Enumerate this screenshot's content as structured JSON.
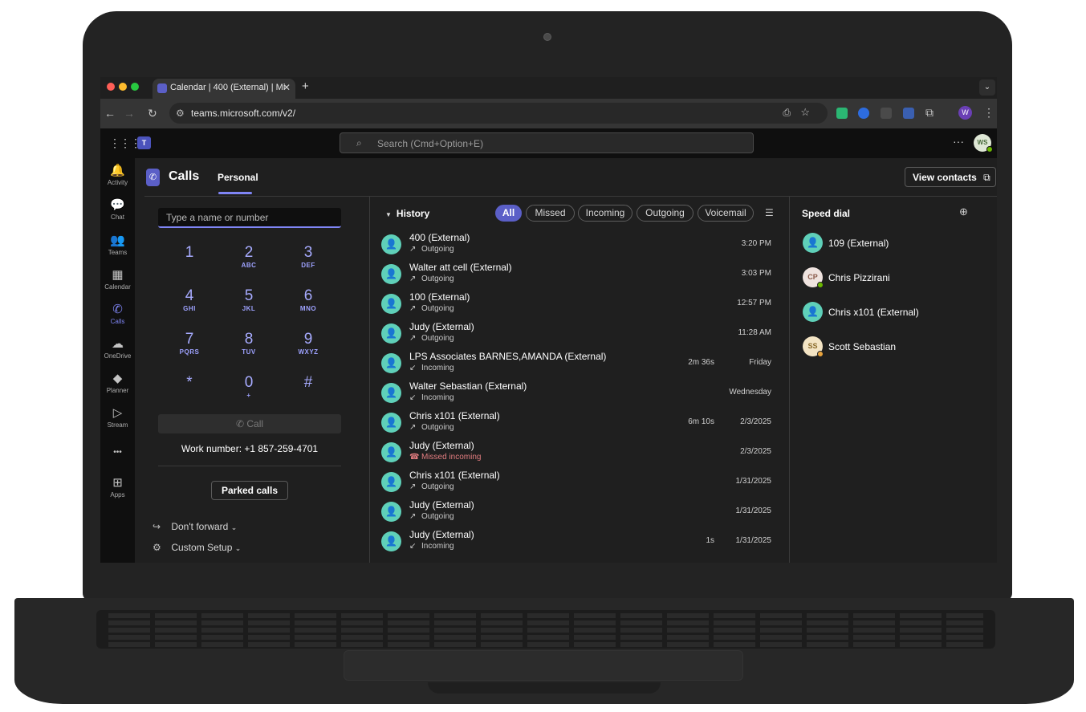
{
  "browser": {
    "tab_title": "Calendar | 400 (External) | Mi",
    "new_tab": "+",
    "tab_close": "✕",
    "url": "teams.microsoft.com/v2/"
  },
  "teams": {
    "logo": "T",
    "search_placeholder": "Search (Cmd+Option+E)",
    "more": "···",
    "me_initials": "WS",
    "profile_initial": "W"
  },
  "rail": [
    {
      "label": "Activity",
      "icon": "bell-icon",
      "glyph": "🔔"
    },
    {
      "label": "Chat",
      "icon": "chat-icon",
      "glyph": "💬"
    },
    {
      "label": "Teams",
      "icon": "teams-icon",
      "glyph": "👥"
    },
    {
      "label": "Calendar",
      "icon": "calendar-icon",
      "glyph": "▦"
    },
    {
      "label": "Calls",
      "icon": "phone-icon",
      "glyph": "✆"
    },
    {
      "label": "OneDrive",
      "icon": "cloud-icon",
      "glyph": "☁"
    },
    {
      "label": "Planner",
      "icon": "planner-icon",
      "glyph": "◆"
    },
    {
      "label": "Stream",
      "icon": "stream-icon",
      "glyph": "▷"
    },
    {
      "label": "",
      "icon": "more-apps-icon",
      "glyph": "•••"
    },
    {
      "label": "Apps",
      "icon": "apps-icon",
      "glyph": "⊞"
    }
  ],
  "header": {
    "title": "Calls",
    "tab_personal": "Personal",
    "view_contacts": "View contacts"
  },
  "dialer": {
    "placeholder": "Type a name or number",
    "keys": [
      {
        "digit": "1",
        "letters": ""
      },
      {
        "digit": "2",
        "letters": "ABC"
      },
      {
        "digit": "3",
        "letters": "DEF"
      },
      {
        "digit": "4",
        "letters": "GHI"
      },
      {
        "digit": "5",
        "letters": "JKL"
      },
      {
        "digit": "6",
        "letters": "MNO"
      },
      {
        "digit": "7",
        "letters": "PQRS"
      },
      {
        "digit": "8",
        "letters": "TUV"
      },
      {
        "digit": "9",
        "letters": "WXYZ"
      },
      {
        "digit": "*",
        "letters": ""
      },
      {
        "digit": "0",
        "letters": "+"
      },
      {
        "digit": "#",
        "letters": ""
      }
    ],
    "call_label": "Call",
    "work_number": "Work number: +1 857-259-4701",
    "parked_calls": "Parked calls",
    "dont_forward": "Don't forward",
    "custom_setup": "Custom Setup"
  },
  "history": {
    "title": "History",
    "filters": [
      "All",
      "Missed",
      "Incoming",
      "Outgoing",
      "Voicemail"
    ],
    "active_filter": "All",
    "rows": [
      {
        "name": "400 (External)",
        "direction": "Outgoing",
        "duration": "",
        "time": "3:20 PM"
      },
      {
        "name": "Walter att cell (External)",
        "direction": "Outgoing",
        "duration": "",
        "time": "3:03 PM"
      },
      {
        "name": "100 (External)",
        "direction": "Outgoing",
        "duration": "",
        "time": "12:57 PM"
      },
      {
        "name": "Judy (External)",
        "direction": "Outgoing",
        "duration": "",
        "time": "11:28 AM"
      },
      {
        "name": "LPS Associates BARNES,AMANDA (External)",
        "direction": "Incoming",
        "duration": "2m 36s",
        "time": "Friday"
      },
      {
        "name": "Walter Sebastian (External)",
        "direction": "Incoming",
        "duration": "",
        "time": "Wednesday"
      },
      {
        "name": "Chris x101 (External)",
        "direction": "Outgoing",
        "duration": "6m 10s",
        "time": "2/3/2025"
      },
      {
        "name": "Judy (External)",
        "direction": "Missed incoming",
        "duration": "",
        "time": "2/3/2025"
      },
      {
        "name": "Chris x101 (External)",
        "direction": "Outgoing",
        "duration": "",
        "time": "1/31/2025"
      },
      {
        "name": "Judy (External)",
        "direction": "Outgoing",
        "duration": "",
        "time": "1/31/2025"
      },
      {
        "name": "Judy (External)",
        "direction": "Incoming",
        "duration": "1s",
        "time": "1/31/2025"
      }
    ]
  },
  "speed_dial": {
    "title": "Speed dial",
    "contacts": [
      {
        "name": "109 (External)",
        "initials": "",
        "avatar_color": "#5fd0b9",
        "initials_color": "#ffffff",
        "presence": ""
      },
      {
        "name": "Chris Pizzirani",
        "initials": "CP",
        "avatar_color": "#efe3df",
        "initials_color": "#8a5a4a",
        "presence": "#6bb700"
      },
      {
        "name": "Chris x101 (External)",
        "initials": "",
        "avatar_color": "#5fd0b9",
        "initials_color": "#ffffff",
        "presence": ""
      },
      {
        "name": "Scott Sebastian",
        "initials": "SS",
        "avatar_color": "#f3e4c4",
        "initials_color": "#8a6a2a",
        "presence": "#e8a33d"
      }
    ]
  },
  "colors": {
    "accent": "#5b5fc7",
    "accent_light": "#7f85f5",
    "avatar_teal": "#5fd0b9",
    "missed_red": "#e37d80"
  }
}
